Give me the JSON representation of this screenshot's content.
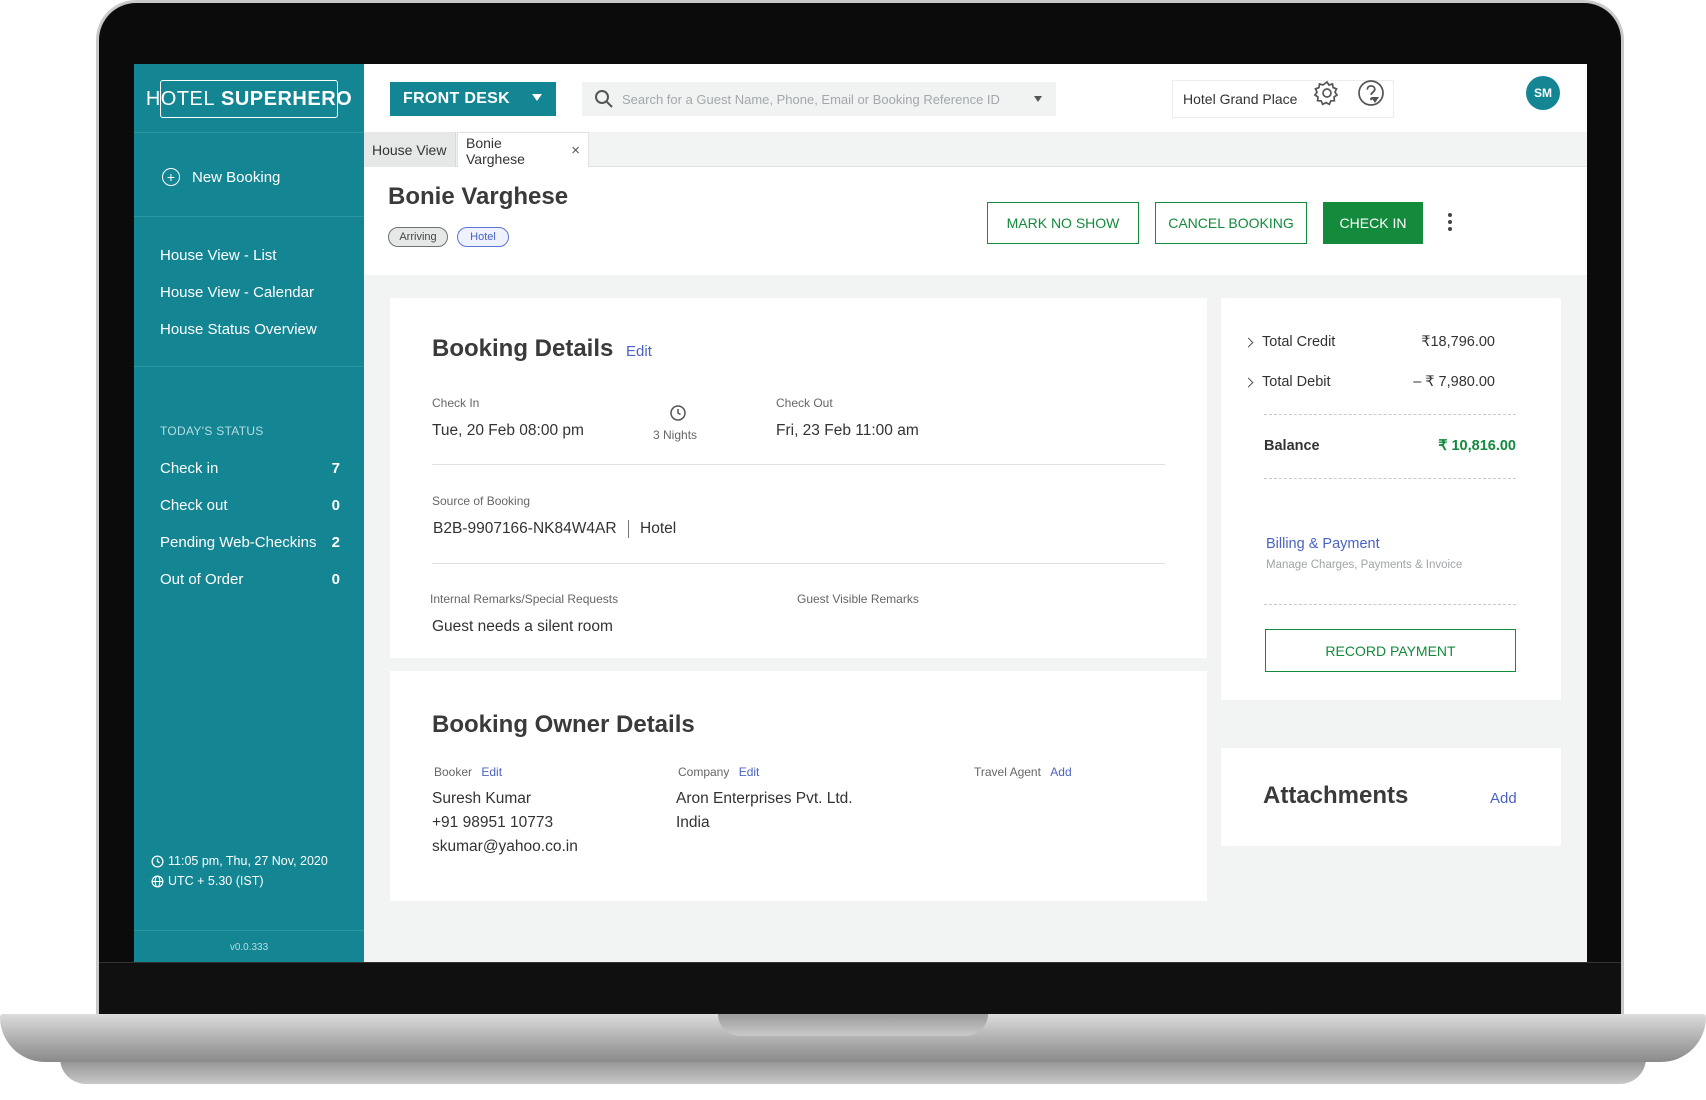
{
  "app": {
    "logo_thin": "HOTEL",
    "logo_bold": "SUPERHERO",
    "version": "v0.0.333"
  },
  "sidebar": {
    "new_booking": "New Booking",
    "nav": [
      "House View - List",
      "House View - Calendar",
      "House Status Overview"
    ],
    "status_heading": "TODAY'S STATUS",
    "status": [
      {
        "label": "Check in",
        "count": "7"
      },
      {
        "label": "Check out",
        "count": "0"
      },
      {
        "label": "Pending Web-Checkins",
        "count": "2"
      },
      {
        "label": "Out of Order",
        "count": "0"
      }
    ],
    "datetime": "11:05 pm, Thu, 27 Nov, 2020",
    "timezone": "UTC + 5.30 (IST)"
  },
  "topbar": {
    "mode": "FRONT DESK",
    "search_placeholder": "Search for a Guest Name, Phone, Email or Booking Reference ID",
    "hotel": "Hotel Grand Place",
    "avatar_initials": "SM"
  },
  "tabs": [
    {
      "label": "House View"
    },
    {
      "label": "Bonie Varghese",
      "close": "×"
    }
  ],
  "guest": {
    "name": "Bonie Varghese",
    "badges": [
      "Arriving",
      "Hotel"
    ],
    "actions": {
      "no_show": "MARK NO SHOW",
      "cancel": "CANCEL BOOKING",
      "check_in": "CHECK IN"
    }
  },
  "booking_details": {
    "title": "Booking Details",
    "edit": "Edit",
    "check_in_label": "Check In",
    "check_in_value": "Tue, 20 Feb 08:00 pm",
    "nights": "3 Nights",
    "check_out_label": "Check Out",
    "check_out_value": "Fri, 23 Feb 11:00 am",
    "source_label": "Source of Booking",
    "source_ref": "B2B-9907166-NK84W4AR",
    "source_type": "Hotel",
    "internal_remarks_label": "Internal Remarks/Special Requests",
    "internal_remarks": "Guest needs a silent room",
    "guest_remarks_label": "Guest Visible Remarks"
  },
  "owner_details": {
    "title": "Booking Owner Details",
    "booker_label": "Booker",
    "booker_edit": "Edit",
    "booker_name": "Suresh Kumar",
    "booker_phone": "+91 98951 10773",
    "booker_email": "skumar@yahoo.co.in",
    "company_label": "Company",
    "company_edit": "Edit",
    "company_name": "Aron Enterprises Pvt. Ltd.",
    "company_country": "India",
    "agent_label": "Travel Agent",
    "agent_add": "Add"
  },
  "summary": {
    "total_credit_label": "Total Credit",
    "total_credit": "₹18,796.00",
    "total_debit_label": "Total Debit",
    "total_debit": "– ₹ 7,980.00",
    "balance_label": "Balance",
    "balance": "₹ 10,816.00",
    "billing_title": "Billing & Payment",
    "billing_sub": "Manage Charges, Payments & Invoice",
    "record_payment": "RECORD PAYMENT"
  },
  "attachments": {
    "title": "Attachments",
    "add": "Add"
  },
  "colors": {
    "sidebar": "#138593",
    "primary_green": "#138a3c",
    "link_blue": "#4a63c2"
  }
}
